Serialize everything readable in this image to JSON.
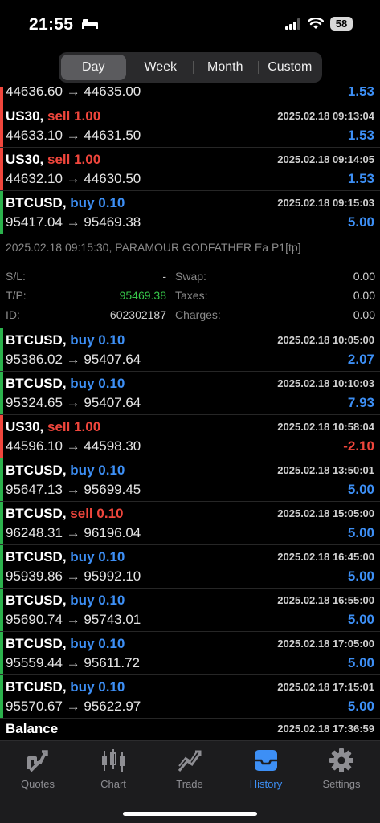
{
  "status": {
    "time": "21:55",
    "battery": "58"
  },
  "periods": [
    "Day",
    "Week",
    "Month",
    "Custom"
  ],
  "deals": [
    {
      "symbol": "",
      "side": "",
      "volume": "",
      "time": "",
      "open": "44636.60",
      "close": "44635.00",
      "profit": "1.53",
      "side_color": "#2bb24c"
    },
    {
      "symbol": "US30,",
      "side": "sell",
      "volume": "1.00",
      "time": "2025.02.18 09:13:04",
      "open": "44633.10",
      "close": "44631.50",
      "profit": "1.53"
    },
    {
      "symbol": "US30,",
      "side": "sell",
      "volume": "1.00",
      "time": "2025.02.18 09:14:05",
      "open": "44632.10",
      "close": "44630.50",
      "profit": "1.53"
    },
    {
      "symbol": "BTCUSD,",
      "side": "buy",
      "volume": "0.10",
      "time": "2025.02.18 09:15:03",
      "open": "95417.04",
      "close": "95469.38",
      "profit": "5.00"
    },
    {
      "symbol": "BTCUSD,",
      "side": "buy",
      "volume": "0.10",
      "time": "2025.02.18 10:05:00",
      "open": "95386.02",
      "close": "95407.64",
      "profit": "2.07"
    },
    {
      "symbol": "BTCUSD,",
      "side": "buy",
      "volume": "0.10",
      "time": "2025.02.18 10:10:03",
      "open": "95324.65",
      "close": "95407.64",
      "profit": "7.93"
    },
    {
      "symbol": "US30,",
      "side": "sell",
      "volume": "1.00",
      "time": "2025.02.18 10:58:04",
      "open": "44596.10",
      "close": "44598.30",
      "profit": "-2.10"
    },
    {
      "symbol": "BTCUSD,",
      "side": "buy",
      "volume": "0.10",
      "time": "2025.02.18 13:50:01",
      "open": "95647.13",
      "close": "95699.45",
      "profit": "5.00"
    },
    {
      "symbol": "BTCUSD,",
      "side": "sell",
      "volume": "0.10",
      "time": "2025.02.18 15:05:00",
      "open": "96248.31",
      "close": "96196.04",
      "profit": "5.00"
    },
    {
      "symbol": "BTCUSD,",
      "side": "buy",
      "volume": "0.10",
      "time": "2025.02.18 16:45:00",
      "open": "95939.86",
      "close": "95992.10",
      "profit": "5.00"
    },
    {
      "symbol": "BTCUSD,",
      "side": "buy",
      "volume": "0.10",
      "time": "2025.02.18 16:55:00",
      "open": "95690.74",
      "close": "95743.01",
      "profit": "5.00"
    },
    {
      "symbol": "BTCUSD,",
      "side": "buy",
      "volume": "0.10",
      "time": "2025.02.18 17:05:00",
      "open": "95559.44",
      "close": "95611.72",
      "profit": "5.00"
    },
    {
      "symbol": "BTCUSD,",
      "side": "buy",
      "volume": "0.10",
      "time": "2025.02.18 17:15:01",
      "open": "95570.67",
      "close": "95622.97",
      "profit": "5.00"
    }
  ],
  "expanded": {
    "comment": "2025.02.18 09:15:30, PARAMOUR GODFATHER Ea P1[tp]",
    "sl_label": "S/L:",
    "sl_value": "-",
    "tp_label": "T/P:",
    "tp_value": "95469.38",
    "id_label": "ID:",
    "id_value": "602302187",
    "swap_label": "Swap:",
    "swap_value": "0.00",
    "taxes_label": "Taxes:",
    "taxes_value": "0.00",
    "charges_label": "Charges:",
    "charges_value": "0.00"
  },
  "balance": {
    "label": "Balance",
    "time": "2025.02.18 17:36:59"
  },
  "tabs": [
    {
      "label": "Quotes",
      "icon": "quotes-icon"
    },
    {
      "label": "Chart",
      "icon": "chart-icon"
    },
    {
      "label": "Trade",
      "icon": "trade-icon"
    },
    {
      "label": "History",
      "icon": "history-icon"
    },
    {
      "label": "Settings",
      "icon": "settings-icon"
    }
  ],
  "colors": {
    "buy": "#3d8ff5",
    "sell": "#f0463c",
    "profit_pos": "#3d8ff5",
    "profit_neg": "#f0463c",
    "tp": "#37c84a"
  }
}
